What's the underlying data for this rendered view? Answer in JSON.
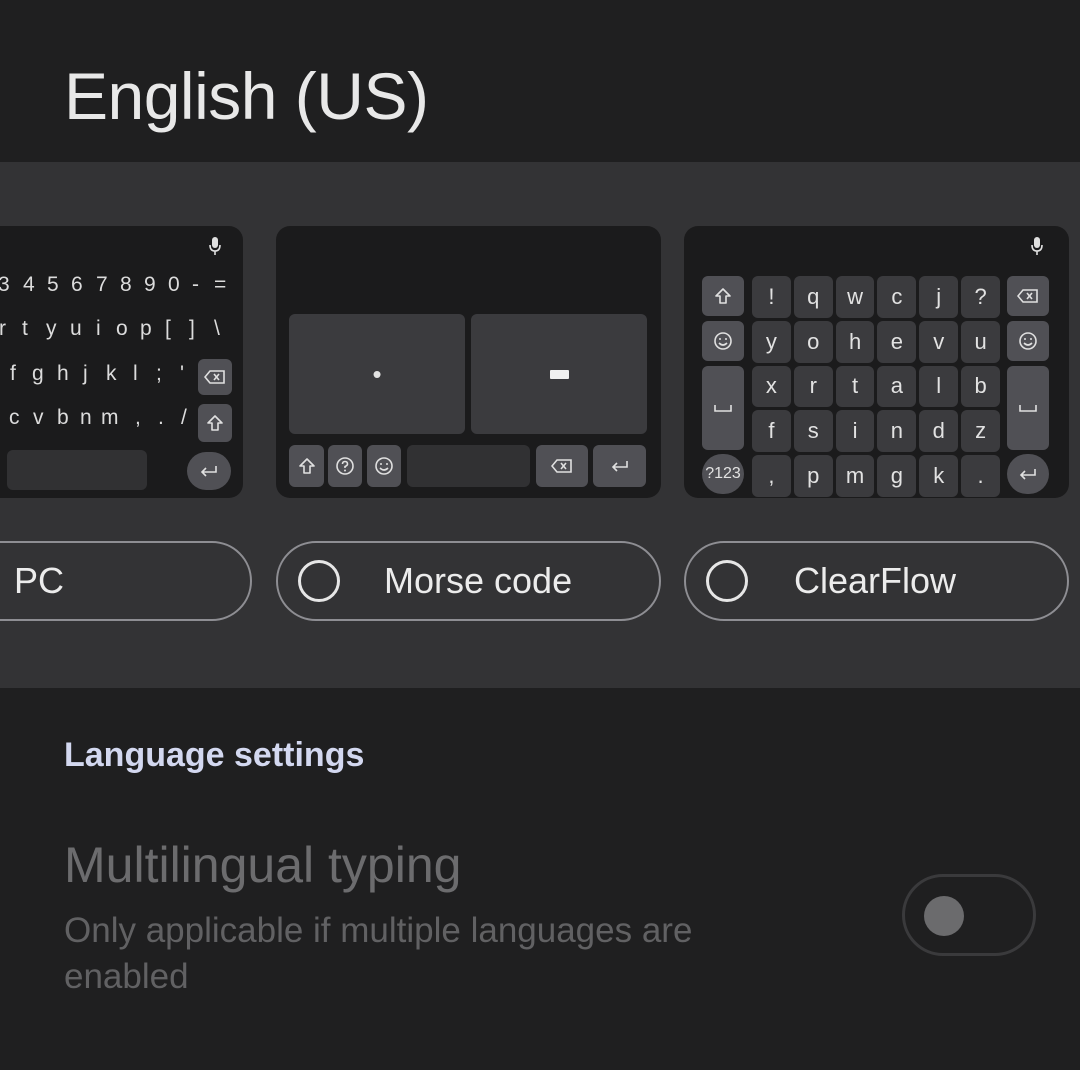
{
  "header": {
    "title": "English (US)"
  },
  "layouts": [
    {
      "label": "PC",
      "rows": [
        [
          "3",
          "4",
          "5",
          "6",
          "7",
          "8",
          "9",
          "0",
          "-",
          "="
        ],
        [
          "r",
          "t",
          "y",
          "u",
          "i",
          "o",
          "p",
          "[",
          "]",
          "\\"
        ],
        [
          "f",
          "g",
          "h",
          "j",
          "k",
          "l",
          ";",
          "'"
        ],
        [
          "c",
          "v",
          "b",
          "n",
          "m",
          ",",
          ".",
          "/"
        ]
      ]
    },
    {
      "label": "Morse code",
      "dot": "•",
      "dash": "-"
    },
    {
      "label": "ClearFlow",
      "symbols_key": "?123",
      "grid": [
        [
          "!",
          "q",
          "w",
          "c",
          "j",
          "?"
        ],
        [
          "y",
          "o",
          "h",
          "e",
          "v",
          "u"
        ],
        [
          "x",
          "r",
          "t",
          "a",
          "l",
          "b"
        ],
        [
          "f",
          "s",
          "i",
          "n",
          "d",
          "z"
        ],
        [
          ",",
          "p",
          "m",
          "g",
          "k",
          "."
        ]
      ]
    }
  ],
  "language_settings": {
    "heading": "Language settings",
    "multilingual": {
      "title": "Multilingual typing",
      "subtitle": "Only applicable if multiple languages are enabled",
      "enabled": false
    }
  },
  "colors": {
    "background": "#1f1f20",
    "band": "#333335",
    "heading_accent": "#d3d8f0"
  },
  "icons": [
    "mic-icon",
    "shift-icon",
    "backspace-icon",
    "enter-icon",
    "emoji-icon",
    "help-icon",
    "space-icon"
  ]
}
